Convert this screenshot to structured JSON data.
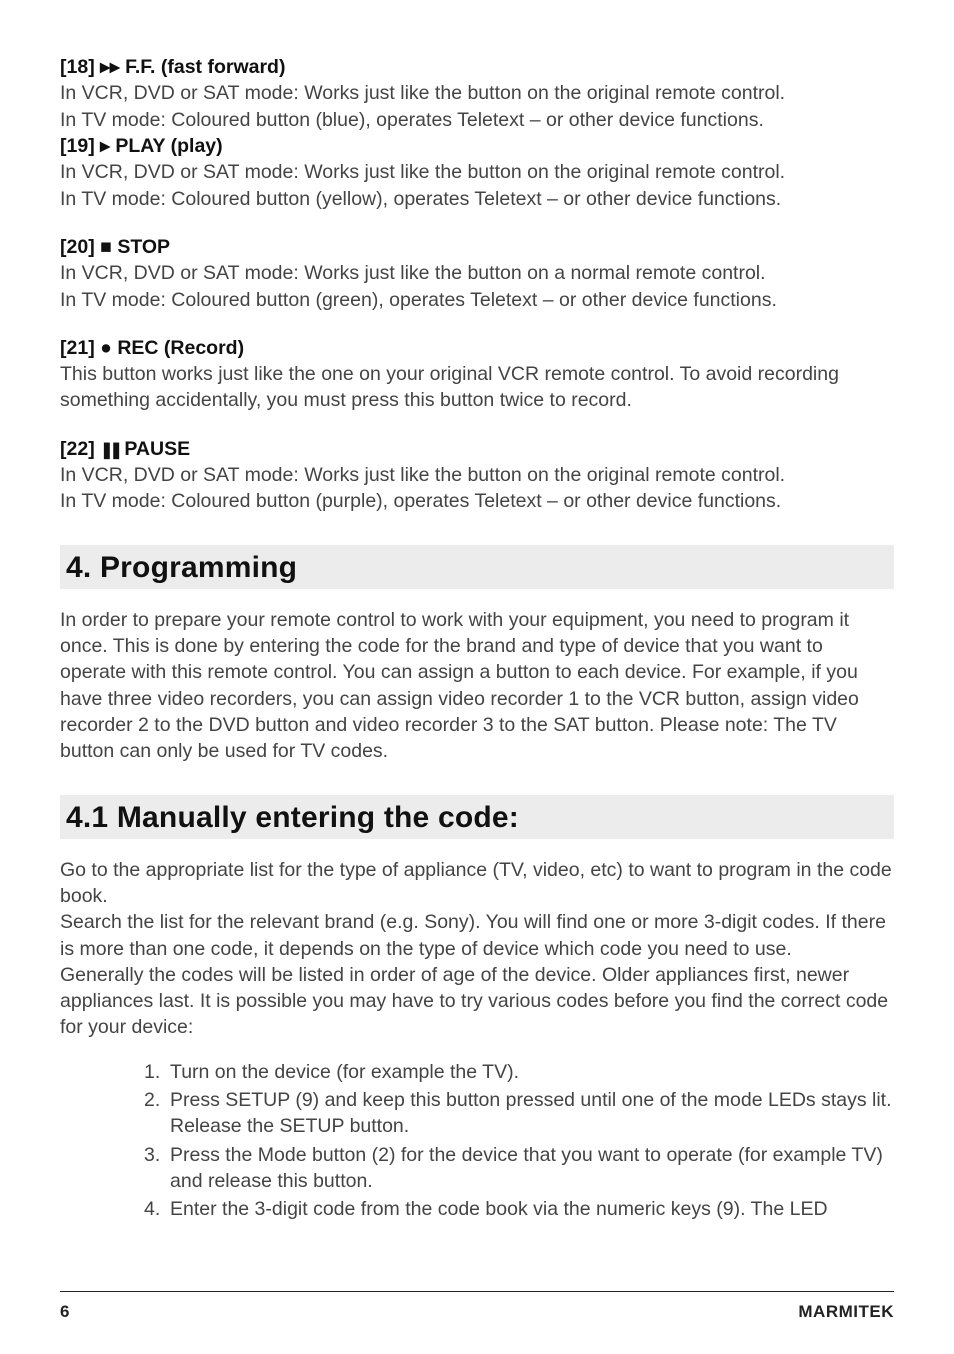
{
  "items": [
    {
      "num": "18",
      "symbol": "▸▸",
      "title": "F.F. (fast forward)",
      "body": "In VCR, DVD or SAT mode: Works just like the button on the original remote control.\nIn TV mode: Coloured button (blue), operates Teletext – or other device functions."
    },
    {
      "num": "19",
      "symbol": "▸",
      "title": "PLAY (play)",
      "body": "In VCR, DVD or SAT mode: Works just like the button on the original remote control.\nIn TV mode: Coloured button (yellow), operates Teletext – or other device functions.",
      "tight": true
    },
    {
      "num": "20",
      "symbol": "■",
      "title": "STOP",
      "body": "In VCR, DVD or SAT mode: Works just like the button on a normal remote control.\nIn TV mode: Coloured button (green), operates Teletext – or other device functions."
    },
    {
      "num": "21",
      "symbol": "●",
      "title": "REC (Record)",
      "body": "This button works just like the one on your original VCR remote control. To avoid recording something accidentally, you must press this button twice to record."
    },
    {
      "num": "22",
      "symbol": "❚❚",
      "title": "PAUSE",
      "body": "In VCR, DVD or SAT mode: Works just like the button on the original remote control.\nIn TV mode: Coloured button (purple), operates Teletext – or other device functions."
    }
  ],
  "section4": {
    "title": "4. Programming",
    "body": "In order to prepare your remote control to work with your equipment, you need to program it once. This is done by entering the code for the brand and type of device that you want to operate with this remote control. You can assign a button to each device. For example, if you have three video recorders, you can assign video recorder 1 to the VCR button, assign video recorder 2 to the DVD button and video recorder 3 to the SAT button. Please note: The TV button can only be used for TV codes."
  },
  "section41": {
    "title": "4.1 Manually entering the code:",
    "body": "Go to the appropriate list for the type of appliance (TV, video, etc) to want to program in the code book.\nSearch the list for the relevant brand (e.g. Sony). You will find one or more 3-digit codes. If there is more than one code, it depends on the type of device which code you need to use.\nGenerally the codes will be listed in order of age of the device. Older appliances first, newer appliances last. It is possible you may have to try various codes before you find the correct code for your device:",
    "steps": [
      "Turn on the device (for example the TV).",
      "Press SETUP (9) and keep this button pressed until one of the mode LEDs stays lit. Release the SETUP button.",
      "Press the Mode button (2) for the device that you want to operate (for example TV) and release this button.",
      "Enter the 3-digit code from the code book via the numeric keys (9). The LED"
    ]
  },
  "footer": {
    "page": "6",
    "brand": "MARMITEK"
  }
}
